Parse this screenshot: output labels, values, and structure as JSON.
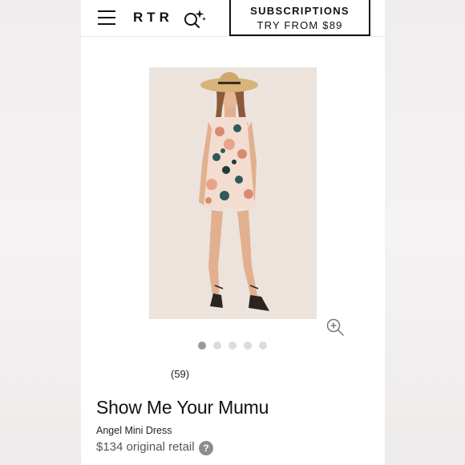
{
  "header": {
    "logo": "RTR",
    "menu_icon": "hamburger-menu-icon",
    "search_icon": "sparkle-search-icon",
    "subscriptions_line1": "SUBSCRIPTIONS",
    "subscriptions_line2": "TRY FROM $89"
  },
  "gallery": {
    "image_count": 5,
    "active_index": 0,
    "zoom_icon": "zoom-in-icon"
  },
  "product": {
    "reviews_count": "(59)",
    "designer": "Show Me Your Mumu",
    "name": "Angel Mini Dress",
    "retail_price": "$134 original retail",
    "help_icon_text": "?"
  },
  "colors": {
    "accent": "#111111",
    "image_background": "#ece3dc",
    "dot_active": "#9a9a9a",
    "dot_inactive": "#dcdcdc"
  }
}
